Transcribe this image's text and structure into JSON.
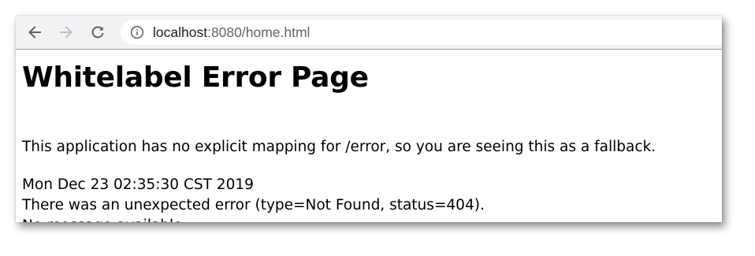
{
  "browser": {
    "url_host": "localhost",
    "url_path": ":8080/home.html",
    "back_icon": "arrow-left",
    "forward_icon": "arrow-right",
    "reload_icon": "reload",
    "site_info_icon": "info-circle"
  },
  "page": {
    "title": "Whitelabel Error Page",
    "description": "This application has no explicit mapping for /error, so you are seeing this as a fallback.",
    "timestamp": "Mon Dec 23 02:35:30 CST 2019",
    "error_line": "There was an unexpected error (type=Not Found, status=404).",
    "message": "No message available"
  }
}
